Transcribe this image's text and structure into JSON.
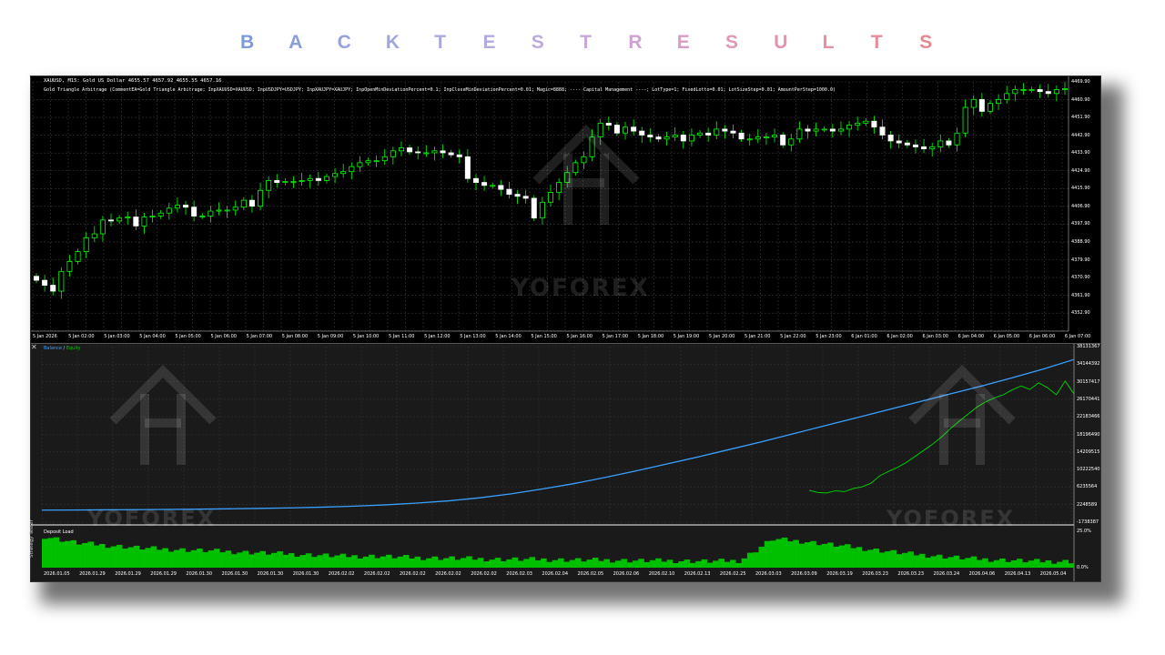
{
  "heading": {
    "letters": [
      "B",
      "A",
      "C",
      "K",
      "T",
      "E",
      "S",
      "T",
      "R",
      "E",
      "S",
      "U",
      "L",
      "T",
      "S"
    ],
    "colors": [
      "#7d9ad8",
      "#8a9ed9",
      "#95a2db",
      "#9fa6dc",
      "#aaa9dd",
      "#b3aade",
      "#bda9dc",
      "#c7a7d8",
      "#d1a2d1",
      "#d99dc5",
      "#df98b8",
      "#e394ad",
      "#e690a2",
      "#e68c98",
      "#e5888f"
    ]
  },
  "price_chart": {
    "symbol_line": "XAUUSD, M15: Gold US Dollar 4655.57 4657.92 4655.55 4657.16",
    "params_line": "Gold Triangle Arbitrage (CommentEA=Gold Triangle Arbitrage; InpXAUUSD=XAUUSD; InpUSDJPY=USDJPY; InpXAUJPY=XAUJPY; InpOpenMinDeviationPercent=0.1; InpCloseMinDeviationPercent=0.01; Magic=8888; ---- Capital Management ----; LotType=1; FixedLotto=0.01; LotSizeStep=0.01; AmountPerStep=1000.0)",
    "price_labels": [
      "4469.90",
      "4460.90",
      "4451.90",
      "4442.90",
      "4433.90",
      "4424.90",
      "4415.90",
      "4406.90",
      "4397.90",
      "4388.90",
      "4379.90",
      "4370.90",
      "4361.90",
      "4352.90"
    ],
    "time_labels": [
      "5 Jan 2026",
      "5 Jan 02:00",
      "5 Jan 03:00",
      "5 Jan 04:00",
      "5 Jan 05:00",
      "5 Jan 06:00",
      "5 Jan 07:00",
      "5 Jan 08:00",
      "5 Jan 09:00",
      "5 Jan 10:00",
      "5 Jan 11:00",
      "5 Jan 12:00",
      "5 Jan 13:00",
      "5 Jan 14:00",
      "5 Jan 15:00",
      "5 Jan 16:00",
      "5 Jan 17:00",
      "5 Jan 18:00",
      "5 Jan 19:00",
      "5 Jan 20:00",
      "5 Jan 21:00",
      "5 Jan 22:00",
      "5 Jan 23:00",
      "6 Jan 01:00",
      "6 Jan 02:00",
      "6 Jan 03:00",
      "6 Jan 04:00",
      "6 Jan 05:00",
      "6 Jan 06:00",
      "6 Jan 07:00"
    ],
    "ylim": [
      4348.9,
      4470.9
    ],
    "closes": [
      4370.5,
      4368.0,
      4365.0,
      4375.0,
      4380.0,
      4385.0,
      4392.0,
      4394.0,
      4401.0,
      4400.5,
      4402.0,
      4402.5,
      4398.0,
      4402.5,
      4403.0,
      4404.5,
      4407.0,
      4408.5,
      4407.5,
      4403.0,
      4403.0,
      4405.5,
      4406.0,
      4406.0,
      4407.5,
      4411.0,
      4408.0,
      4416.0,
      4421.0,
      4420.0,
      4420.5,
      4420.5,
      4421.0,
      4422.0,
      4421.0,
      4423.0,
      4424.5,
      4425.5,
      4428.0,
      4430.0,
      4431.0,
      4431.0,
      4433.0,
      4436.0,
      4437.5,
      4435.5,
      4435.0,
      4435.0,
      4436.0,
      4435.0,
      4434.0,
      4433.0,
      4422.0,
      4420.0,
      4418.5,
      4418.5,
      4416.5,
      4414.0,
      4413.0,
      4412.0,
      4402.0,
      4410.0,
      4415.0,
      4420.0,
      4425.0,
      4430.0,
      4433.0,
      4443.0,
      4450.0,
      4449.0,
      4445.0,
      4448.0,
      4446.0,
      4444.0,
      4443.0,
      4442.0,
      4443.0,
      4444.0,
      4441.0,
      4444.0,
      4445.0,
      4444.0,
      4447.0,
      4446.0,
      4445.0,
      4442.0,
      4442.0,
      4443.0,
      4443.0,
      4444.0,
      4439.0,
      4442.0,
      4447.0,
      4446.0,
      4447.0,
      4447.0,
      4446.0,
      4447.0,
      4449.0,
      4450.0,
      4451.0,
      4448.0,
      4444.0,
      4441.0,
      4440.0,
      4439.0,
      4438.0,
      4437.0,
      4438.0,
      4441.0,
      4439.0,
      4445.0,
      4458.0,
      4462.0,
      4456.0,
      4460.0,
      4462.0,
      4465.0,
      4467.0,
      4467.0,
      4467.0,
      4466.0,
      4465.0,
      4467.0,
      4467.5
    ]
  },
  "tester": {
    "legend": {
      "balance": "Balance",
      "separator": " / ",
      "equity": "Equity"
    },
    "side_label": "Strategy Tester",
    "close_symbol": "✕",
    "balance_labels": [
      "38131367",
      "34144392",
      "30157417",
      "26170441",
      "22183466",
      "18196490",
      "14209515",
      "10222540",
      "6235564",
      "2248589",
      "-1738387"
    ],
    "deposit_label": "Deposit Load",
    "deposit_scale": [
      "25.0%",
      "0.0%"
    ],
    "date_labels": [
      "2026.01.05",
      "2026.01.29",
      "2026.01.29",
      "2026.01.29",
      "2026.01.30",
      "2026.01.30",
      "2026.01.30",
      "2026.01.30",
      "2026.02.02",
      "2026.02.02",
      "2026.02.02",
      "2026.02.02",
      "2026.02.02",
      "2026.02.03",
      "2026.02.04",
      "2026.02.05",
      "2026.02.06",
      "2026.02.10",
      "2026.02.13",
      "2026.02.25",
      "2026.03.03",
      "2026.03.09",
      "2026.03.19",
      "2026.03.23",
      "2026.03.23",
      "2026.03.24",
      "2026.04.06",
      "2026.04.13",
      "2026.05.04"
    ],
    "balance_ylim": [
      -1738387,
      38131367
    ],
    "balance_series": [
      1000000,
      1030000,
      1060000,
      1100000,
      1150000,
      1220000,
      1300000,
      1400000,
      1520000,
      1680000,
      1900000,
      2200000,
      2600000,
      3100000,
      3800000,
      4700000,
      5800000,
      7000000,
      8400000,
      9900000,
      11500000,
      13100000,
      14800000,
      16500000,
      18300000,
      20100000,
      21900000,
      23700000,
      25500000,
      27300000,
      29100000,
      31000000,
      33000000,
      35200000
    ],
    "equity_series": [
      5500000,
      5000000,
      4900000,
      5400000,
      5200000,
      5900000,
      6300000,
      7100000,
      8800000,
      9800000,
      10700000,
      11800000,
      13200000,
      14600000,
      16000000,
      17600000,
      19500000,
      21200000,
      22800000,
      24400000,
      25600000,
      26500000,
      27200000,
      28300000,
      29200000,
      28400000,
      29900000,
      28800000,
      27200000,
      30300000,
      27400000
    ],
    "deposit_load": [
      0.22,
      0.17,
      0.15,
      0.13,
      0.12,
      0.11,
      0.1,
      0.09,
      0.08,
      0.07,
      0.07,
      0.06,
      0.055,
      0.05,
      0.045,
      0.045,
      0.04,
      0.04,
      0.035,
      0.035,
      0.03,
      0.035,
      0.2,
      0.18,
      0.15,
      0.12,
      0.09,
      0.07,
      0.05,
      0.04,
      0.03,
      0.03
    ]
  },
  "watermarks": {
    "brand": "YOFOREX"
  }
}
